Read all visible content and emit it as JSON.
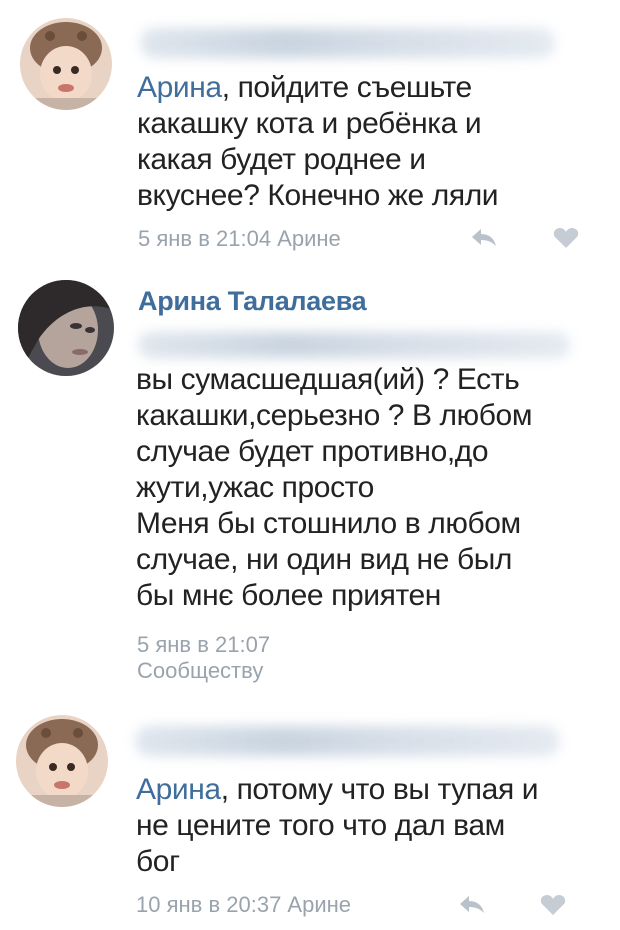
{
  "comments": [
    {
      "author_visible": false,
      "mention": "Арина",
      "text_after_mention": ", пойдите съешьте\nкакашку кота и ребёнка и\nкакая будет роднее и\nвкуснее? Конечно же ляли",
      "meta": "5 янв в 21:04 Арине",
      "reply_icon": "reply-icon",
      "like_icon": "heart-icon"
    },
    {
      "author": "Арина Талалаева",
      "text": "вы сумасшедшая(ий) ? Есть\nкакашки,серьезно ? В любом\nслучае будет противно,до\nжути,ужас просто\nМеня бы стошнило в любом\nслучае, ни один вид не был\nбы мнє более приятен",
      "meta": "5 янв в 21:07\nСообществу"
    },
    {
      "author_visible": false,
      "mention": "Арина",
      "text_after_mention": ", потому что вы тупая и\nне цените того что дал вам\nбог",
      "meta": "10 янв в 20:37 Арине",
      "reply_icon": "reply-icon",
      "like_icon": "heart-icon"
    }
  ],
  "colors": {
    "link": "#3f6e9c",
    "meta": "#9aa3ad",
    "text": "#222222"
  }
}
